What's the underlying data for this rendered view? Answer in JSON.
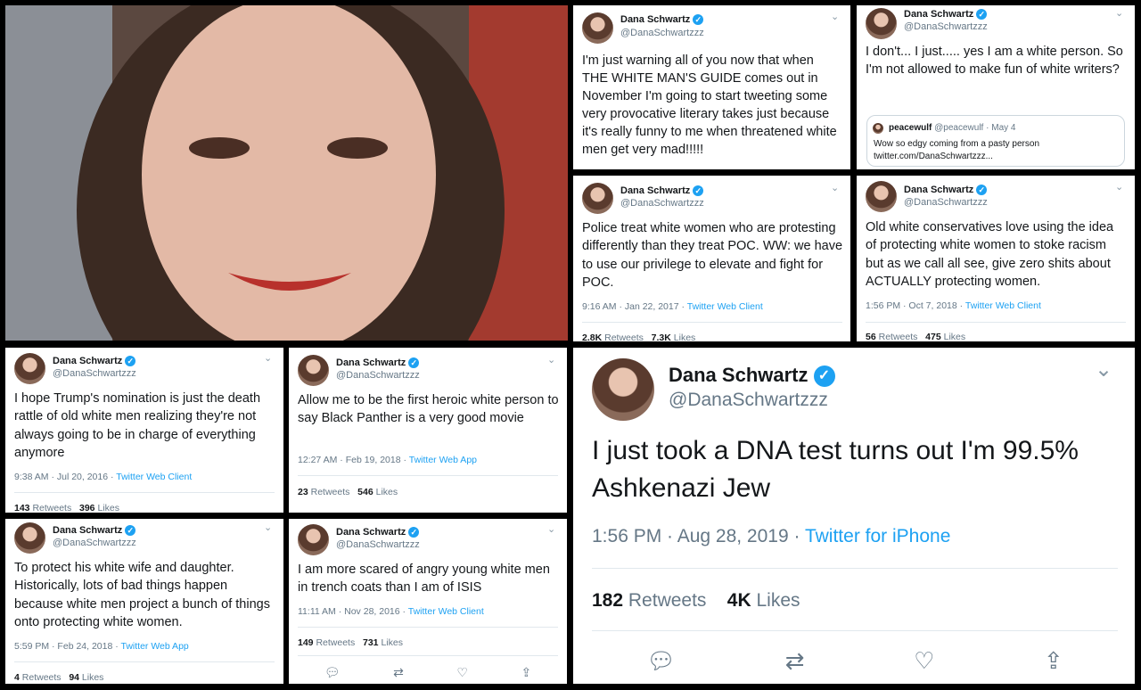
{
  "user": {
    "name": "Dana Schwartz",
    "handle": "@DanaSchwartzzz"
  },
  "tweets": {
    "t1": {
      "text": "I'm just warning all of you now that when THE WHITE MAN'S GUIDE comes out in November I'm going to start tweeting some very provocative literary takes just because it's really funny to me when threatened white men get very mad!!!!!"
    },
    "t2": {
      "text": "I don't... I just..... yes I am a white person. So I'm not allowed to make fun of white writers?",
      "quote": {
        "name": "peacewulf",
        "handle": "@peacewulf",
        "date": "May 4",
        "text": "Wow so edgy coming from a pasty person twitter.com/DanaSchwartzzz..."
      }
    },
    "t3": {
      "text": "Police treat white women who are protesting differently than they treat POC. WW: we have to use our privilege to elevate and fight for POC.",
      "time": "9:16 AM · Jan 22, 2017",
      "source": "Twitter Web Client",
      "retweets": "2.8K",
      "likes": "7.3K"
    },
    "t4": {
      "text": "Old white conservatives love using the idea of protecting white women to stoke racism but as we call all see, give zero shits about ACTUALLY protecting women.",
      "time": "1:56 PM · Oct 7, 2018",
      "source": "Twitter Web Client",
      "retweets": "56",
      "likes": "475"
    },
    "t5": {
      "text": "I hope Trump's nomination is just the death rattle of old white men realizing they're not always going to be in charge of everything anymore",
      "time": "9:38 AM · Jul 20, 2016",
      "source": "Twitter Web Client",
      "retweets": "143",
      "likes": "396"
    },
    "t6": {
      "text": "Allow me to be the first heroic white person to say Black Panther is a very good movie",
      "time": "12:27 AM · Feb 19, 2018",
      "source": "Twitter Web App",
      "retweets": "23",
      "likes": "546"
    },
    "t7": {
      "text": "To protect his white wife and daughter. Historically, lots of bad things happen because white men project a bunch of things onto protecting white women.",
      "time": "5:59 PM · Feb 24, 2018",
      "source": "Twitter Web App",
      "retweets": "4",
      "likes": "94"
    },
    "t8": {
      "text": "I am more scared of angry young white men in trench coats than I am of ISIS",
      "time": "11:11 AM · Nov 28, 2016",
      "source": "Twitter Web Client",
      "retweets": "149",
      "likes": "731"
    },
    "t9": {
      "text": "I just took a DNA test turns out I'm 99.5% Ashkenazi Jew",
      "time": "1:56 PM · Aug 28, 2019",
      "source": "Twitter for iPhone",
      "retweets": "182",
      "likes": "4K"
    }
  },
  "labels": {
    "retweets": "Retweets",
    "likes": "Likes",
    "separator": "·"
  },
  "icons": {
    "verified": "verified-check-icon",
    "chevron": "chevron-down-icon",
    "reply": "reply-icon",
    "retweet": "retweet-icon",
    "like": "heart-icon",
    "share": "share-icon"
  },
  "colors": {
    "accent": "#1da1f2",
    "text": "#14171a",
    "muted": "#657786"
  }
}
